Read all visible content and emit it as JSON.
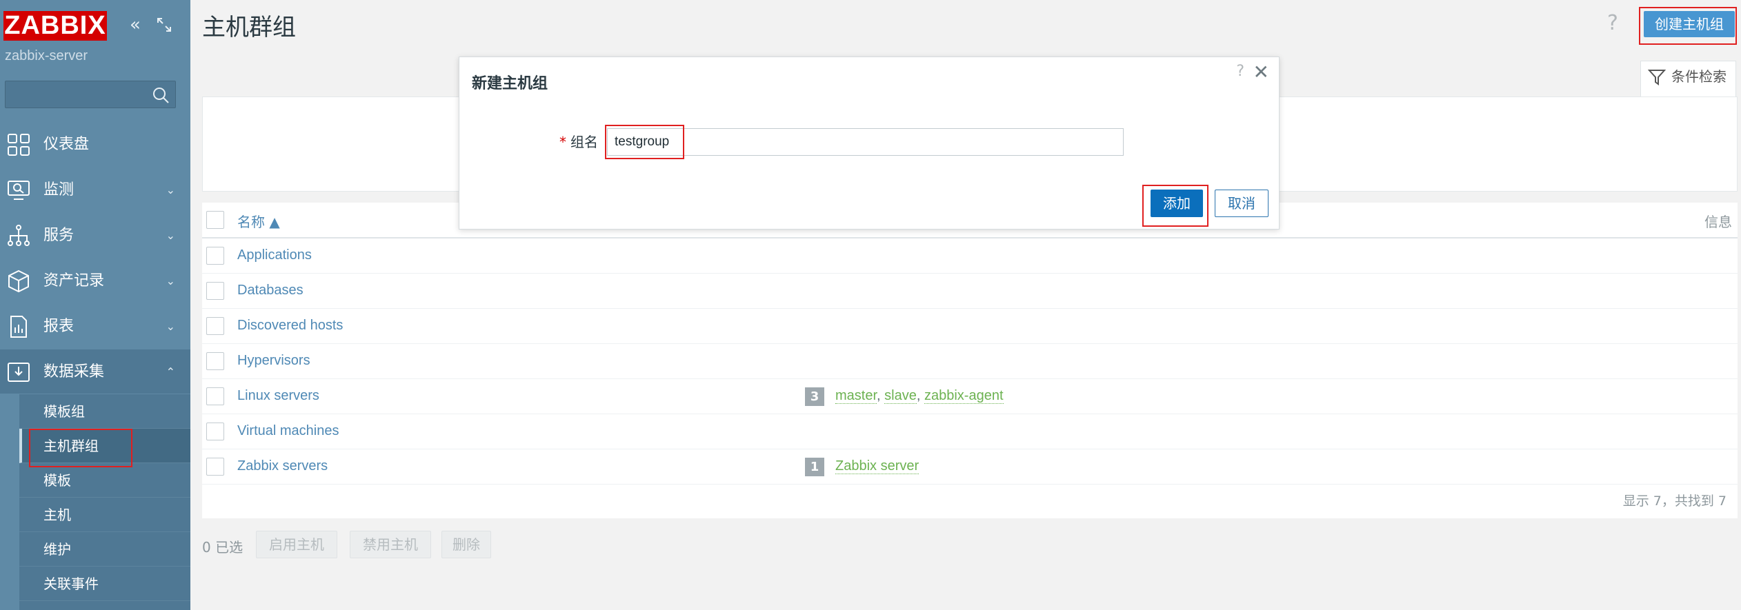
{
  "sidebar": {
    "logo": "ZABBIX",
    "server_name": "zabbix-server",
    "search_placeholder": "",
    "nav": [
      {
        "label": "仪表盘",
        "icon": "dashboard-icon"
      },
      {
        "label": "监测",
        "icon": "monitoring-icon"
      },
      {
        "label": "服务",
        "icon": "services-icon"
      },
      {
        "label": "资产记录",
        "icon": "inventory-icon"
      },
      {
        "label": "报表",
        "icon": "reports-icon"
      },
      {
        "label": "数据采集",
        "icon": "data-collection-icon"
      }
    ],
    "sub_items": [
      "模板组",
      "主机群组",
      "模板",
      "主机",
      "维护",
      "关联事件"
    ],
    "active_sub": "主机群组"
  },
  "header": {
    "title": "主机群组",
    "help": "?",
    "create_label": "创建主机组"
  },
  "filter": {
    "label": "条件检索"
  },
  "table": {
    "col_name": "名称 ▲",
    "col_info": "信息",
    "rows": [
      {
        "name": "Applications",
        "count": "",
        "hosts": []
      },
      {
        "name": "Databases",
        "count": "",
        "hosts": []
      },
      {
        "name": "Discovered hosts",
        "count": "",
        "hosts": []
      },
      {
        "name": "Hypervisors",
        "count": "",
        "hosts": []
      },
      {
        "name": "Linux servers",
        "count": "3",
        "hosts": [
          "master",
          "slave",
          "zabbix-agent"
        ]
      },
      {
        "name": "Virtual machines",
        "count": "",
        "hosts": []
      },
      {
        "name": "Zabbix servers",
        "count": "1",
        "hosts": [
          "Zabbix server"
        ]
      }
    ],
    "paging": "显示 7，共找到 7"
  },
  "bottom": {
    "selected": "0 已选",
    "enable": "启用主机",
    "disable": "禁用主机",
    "delete": "删除"
  },
  "modal": {
    "title": "新建主机组",
    "help": "?",
    "close": "✕",
    "required_mark": "*",
    "field_label": "组名",
    "field_value": "testgroup",
    "add_label": "添加",
    "cancel_label": "取消"
  },
  "colors": {
    "sidebar": "#5f8aa6",
    "brand_red": "#d40000",
    "primary": "#0b6fbc",
    "link": "#4f89b5",
    "host_link": "#6cb251",
    "highlight": "#e02020"
  }
}
